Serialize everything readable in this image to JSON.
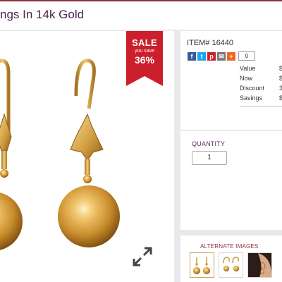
{
  "product": {
    "title": "ngs In 14k Gold"
  },
  "badge": {
    "line1": "SALE",
    "line2": "you save",
    "line3": "36%",
    "color": "#cc1f2d"
  },
  "item": {
    "label": "ITEM# 16440"
  },
  "share": {
    "buttons": [
      {
        "icon": "facebook-icon",
        "glyph": "f",
        "color": "#3b5998"
      },
      {
        "icon": "twitter-icon",
        "glyph": "t",
        "color": "#1da1f2"
      },
      {
        "icon": "pinterest-icon",
        "glyph": "p",
        "color": "#cb2027"
      },
      {
        "icon": "email-icon",
        "glyph": "✉",
        "color": "#777777"
      },
      {
        "icon": "plus-icon",
        "glyph": "+",
        "color": "#f26522"
      }
    ],
    "count": "0"
  },
  "pricing": {
    "rows": [
      {
        "label": "Value",
        "value": "$"
      },
      {
        "label": "Now",
        "value": "$"
      },
      {
        "label": "Discount",
        "value": "3"
      },
      {
        "label": "Savings",
        "value": "$"
      }
    ]
  },
  "quantity": {
    "label": "QUANTITY",
    "value": "1"
  },
  "alternate": {
    "label": "ALTERNATE IMAGES"
  },
  "icons": {
    "expand": "expand-icon"
  },
  "colors": {
    "title": "#4d2350",
    "accent": "#8b2f3f",
    "gold": "#d9a441"
  }
}
